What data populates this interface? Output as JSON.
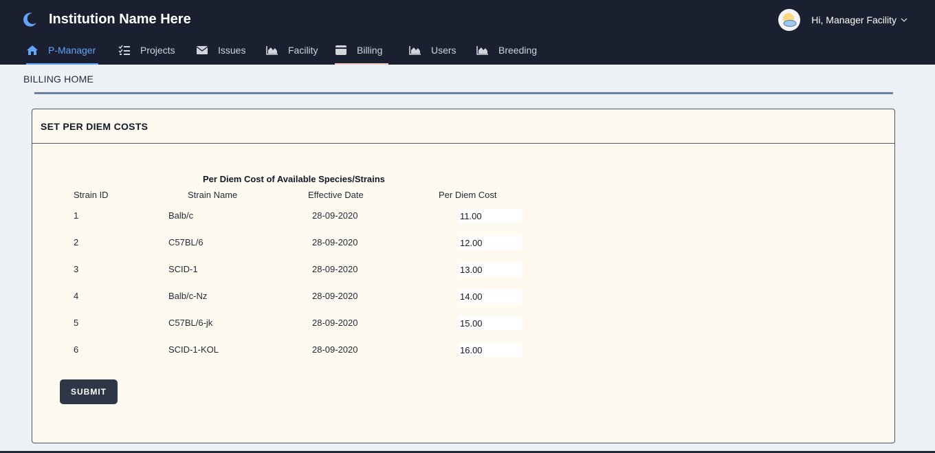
{
  "header": {
    "institution_name": "Institution Name Here",
    "greeting": "Hi, Manager Facility"
  },
  "nav": {
    "items": [
      {
        "label": "P-Manager",
        "icon": "home-icon"
      },
      {
        "label": "Projects",
        "icon": "checklist-icon"
      },
      {
        "label": "Issues",
        "icon": "envelope-icon"
      },
      {
        "label": "Facility",
        "icon": "area-chart-icon"
      },
      {
        "label": "Billing",
        "icon": "wallet-icon"
      },
      {
        "label": "Users",
        "icon": "area-chart-icon"
      },
      {
        "label": "Breeding",
        "icon": "area-chart-icon"
      }
    ],
    "active": "P-Manager"
  },
  "page": {
    "title": "BILLING HOME"
  },
  "card": {
    "title": "SET PER DIEM COSTS",
    "table_caption": "Per Diem Cost of Available Species/Strains",
    "columns": [
      "Strain ID",
      "Strain Name",
      "Effective Date",
      "Per Diem Cost"
    ],
    "rows": [
      {
        "id": "1",
        "name": "Balb/c",
        "date": "28-09-2020",
        "cost": "11.00"
      },
      {
        "id": "2",
        "name": "C57BL/6",
        "date": "28-09-2020",
        "cost": "12.00"
      },
      {
        "id": "3",
        "name": "SCID-1",
        "date": "28-09-2020",
        "cost": "13.00"
      },
      {
        "id": "4",
        "name": "Balb/c-Nz",
        "date": "28-09-2020",
        "cost": "14.00"
      },
      {
        "id": "5",
        "name": "C57BL/6-jk",
        "date": "28-09-2020",
        "cost": "15.00"
      },
      {
        "id": "6",
        "name": "SCID-1-KOL",
        "date": "28-09-2020",
        "cost": "16.00"
      }
    ],
    "submit_label": "SUBMIT"
  },
  "colors": {
    "topbar": "#1a2030",
    "accent": "#60a5fa",
    "card_bg": "#fefaf0",
    "button": "#2d3748"
  }
}
